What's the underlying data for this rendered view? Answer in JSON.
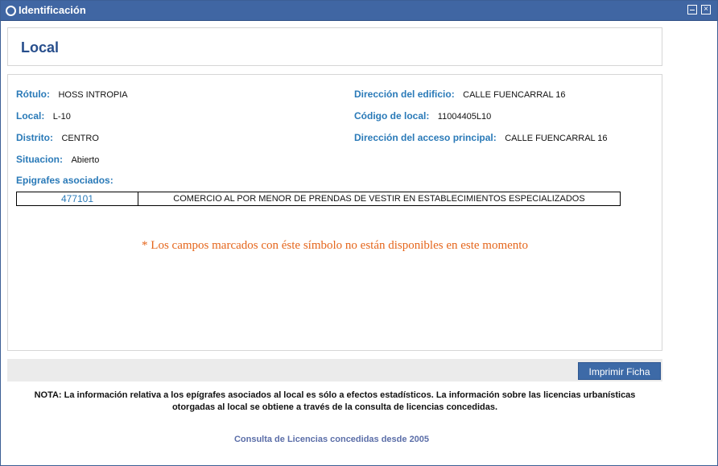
{
  "window": {
    "title": "Identificación",
    "minimize_label": "",
    "close_label": "×"
  },
  "header": {
    "title": "Local"
  },
  "fields": {
    "rotulo": {
      "label": "Rótulo:",
      "value": "HOSS INTROPIA"
    },
    "local": {
      "label": "Local:",
      "value": "L-10"
    },
    "distrito": {
      "label": "Distrito:",
      "value": "CENTRO"
    },
    "situacion": {
      "label": "Situacion:",
      "value": "Abierto"
    },
    "direccion_edificio": {
      "label": "Dirección del edificio:",
      "value": "CALLE FUENCARRAL 16"
    },
    "codigo_local": {
      "label": "Código de local:",
      "value": "11004405L10"
    },
    "direccion_acceso": {
      "label": "Dirección del acceso principal:",
      "value": "CALLE FUENCARRAL 16"
    }
  },
  "epigrafes": {
    "label": "Epigrafes asociados:",
    "rows": [
      {
        "code": "477101",
        "description": "COMERCIO AL POR MENOR DE PRENDAS DE VESTIR EN ESTABLECIMIENTOS ESPECIALIZADOS"
      }
    ]
  },
  "notice": "* Los campos marcados con éste símbolo no están disponibles en este momento",
  "toolbar": {
    "print_label": "Imprimir Ficha"
  },
  "note": {
    "line1": "NOTA: La información relativa a los epígrafes asociados al local es sólo a efectos estadísticos. La información sobre las licencias urbanísticas",
    "line2": "otorgadas al local se obtiene a través de la consulta de licencias concedidas."
  },
  "link": {
    "label": "Consulta de Licencias concedidas desde 2005"
  },
  "colors": {
    "titlebar": "#4066a3",
    "label": "#2a7ab8",
    "notice": "#e5661c",
    "button": "#3d6aa7",
    "link": "#5b6ea8"
  }
}
